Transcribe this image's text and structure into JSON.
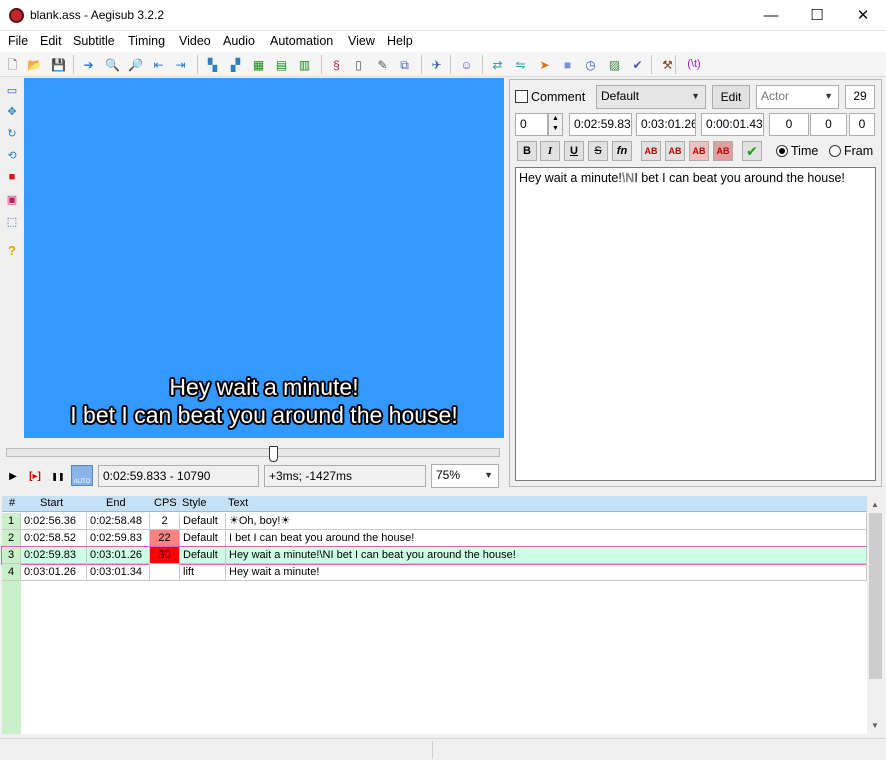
{
  "window": {
    "title": "blank.ass - Aegisub 3.2.2",
    "min_glyph": "—",
    "max_glyph": "☐",
    "close_glyph": "✕"
  },
  "menu": [
    "File",
    "Edit",
    "Subtitle",
    "Timing",
    "Video",
    "Audio",
    "Automation",
    "View",
    "Help"
  ],
  "toolbar_icons": [
    {
      "name": "new-file-icon",
      "glyph": "🗋"
    },
    {
      "name": "open-file-icon",
      "glyph": "📂"
    },
    {
      "name": "save-icon",
      "glyph": "💾"
    },
    {
      "name": "jump-to-icon",
      "glyph": "➔"
    },
    {
      "name": "zoom-in-icon",
      "glyph": "🔍"
    },
    {
      "name": "zoom-out-icon",
      "glyph": "🔎"
    },
    {
      "name": "snap-start-icon",
      "glyph": "⇤"
    },
    {
      "name": "snap-end-icon",
      "glyph": "⇥"
    },
    {
      "name": "styles-manager-icon",
      "glyph": "▚"
    },
    {
      "name": "attachments-icon",
      "glyph": "▞"
    },
    {
      "name": "properties-icon",
      "glyph": "▦"
    },
    {
      "name": "fonts-collector-icon",
      "glyph": "▤"
    },
    {
      "name": "translation-icon",
      "glyph": "▥"
    },
    {
      "name": "automation-icon",
      "glyph": "§"
    },
    {
      "name": "resample-icon",
      "glyph": "▯"
    },
    {
      "name": "timing-postproc-icon",
      "glyph": "✎"
    },
    {
      "name": "kanji-timer-icon",
      "glyph": "⧉"
    },
    {
      "name": "shift-times-icon",
      "glyph": "✈"
    },
    {
      "name": "visual-typesetting-icon",
      "glyph": "☺"
    },
    {
      "name": "find-icon",
      "glyph": "⇄"
    },
    {
      "name": "replace-icon",
      "glyph": "⇋"
    },
    {
      "name": "fish-icon",
      "glyph": "➤"
    },
    {
      "name": "stop-icon",
      "glyph": "■"
    },
    {
      "name": "clock-icon",
      "glyph": "◷"
    },
    {
      "name": "select-lines-icon",
      "glyph": "▨"
    },
    {
      "name": "spellcheck-icon",
      "glyph": "✔"
    },
    {
      "name": "tools-icon",
      "glyph": "⚒"
    },
    {
      "name": "tag-toggle-icon",
      "glyph": "(\\t)"
    }
  ],
  "video_tools": [
    {
      "name": "standard-tool-icon",
      "glyph": "▭"
    },
    {
      "name": "drag-tool-icon",
      "glyph": "✥"
    },
    {
      "name": "rotate-z-icon",
      "glyph": "↻"
    },
    {
      "name": "rotate-xy-icon",
      "glyph": "⟲"
    },
    {
      "name": "scale-tool-icon",
      "glyph": "■"
    },
    {
      "name": "clip-rect-icon",
      "glyph": "▣"
    },
    {
      "name": "vector-clip-icon",
      "glyph": "⬚"
    },
    {
      "name": "help-icon",
      "glyph": "?"
    }
  ],
  "video": {
    "subtitle_lines": [
      "Hey wait a minute!",
      "I bet I can beat you around the house!"
    ],
    "seek_position": 0.54
  },
  "playback": {
    "play_glyph": "▶",
    "play_line_glyph": "[▸]",
    "pause_glyph": "❚❚",
    "auto_label": "AUTO",
    "time_display": "0:02:59.833 - 10790",
    "offset_display": "+3ms; -1427ms",
    "zoom": "75%"
  },
  "edit": {
    "comment_label": "Comment",
    "style": "Default",
    "edit_button": "Edit",
    "actor_placeholder": "Actor",
    "char_count": "29",
    "layer": "0",
    "start_time": "0:02:59.83",
    "end_time": "0:03:01.26",
    "duration": "0:00:01.43",
    "margin_left": "0",
    "margin_right": "0",
    "margin_vert": "0",
    "bold": "B",
    "italic": "I",
    "underline": "U",
    "strike": "S",
    "font": "fn",
    "color_labels": [
      "AB",
      "AB",
      "AB",
      "AB"
    ],
    "commit_glyph": "✔",
    "time_label": "Time",
    "frame_label": "Fram",
    "text_before": "Hey wait a minute!",
    "text_tag": "\\N",
    "text_after": "I bet I can beat you around the house!"
  },
  "grid": {
    "headers": [
      "#",
      "Start",
      "End",
      "CPS",
      "Style",
      "Text"
    ],
    "rows": [
      {
        "num": "1",
        "start": "0:02:56.36",
        "end": "0:02:58.48",
        "cps": "2",
        "style": "Default",
        "text": "☀Oh, boy!☀",
        "cps_color": "#ffffff",
        "selected": false
      },
      {
        "num": "2",
        "start": "0:02:58.52",
        "end": "0:02:59.83",
        "cps": "22",
        "style": "Default",
        "text": "I bet I can beat you around the house!",
        "cps_color": "#ff8080",
        "selected": false
      },
      {
        "num": "3",
        "start": "0:02:59.83",
        "end": "0:03:01.26",
        "cps": "30",
        "style": "Default",
        "text": "Hey wait a minute!\\NI bet I can beat you around the house!",
        "cps_color": "#ff0000",
        "selected": true
      },
      {
        "num": "4",
        "start": "0:03:01.26",
        "end": "0:03:01.34",
        "cps": "",
        "style": "lift",
        "text": "Hey wait a minute!",
        "cps_color": "#ffffff",
        "selected": false
      }
    ]
  },
  "colors": {
    "video_bg": "#3399ff",
    "grid_header": "#c6e1f5",
    "selected_row": "#ccffe6",
    "row_num_bg": "#c9f0c9",
    "tag_color": "#808080"
  }
}
